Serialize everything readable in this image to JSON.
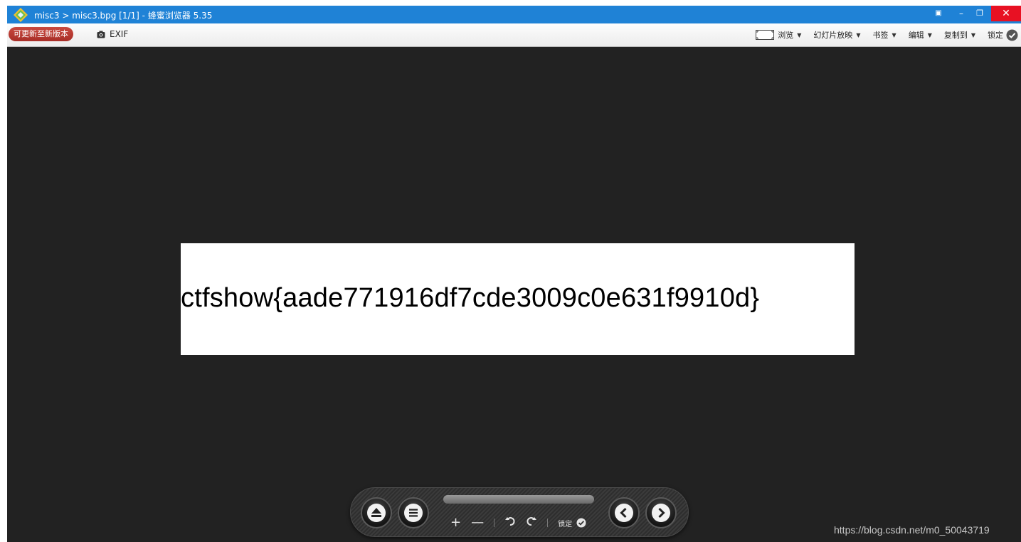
{
  "titlebar": {
    "title": "misc3 > misc3.bpg [1/1] - 蜂蜜浏览器 5.35",
    "close_symbol": "✕"
  },
  "toolbar": {
    "update_label": "可更新至新版本",
    "exif_label": "EXIF",
    "browse_label": "浏览",
    "slideshow_label": "幻灯片放映",
    "bookmark_label": "书签",
    "edit_label": "编辑",
    "copy_to_label": "复制到",
    "lock_label": "锁定"
  },
  "image": {
    "text": "ctfshow{aade771916df7cde3009c0e631f9910d}"
  },
  "controls": {
    "lock_label": "锁定",
    "zoom_in": "+",
    "zoom_out": "—"
  },
  "watermark": "https://blog.csdn.net/m0_50043719",
  "colors": {
    "titlebar": "#1f82d6",
    "background": "#222222",
    "close_button": "#e81123",
    "update_button": "#b8392f"
  }
}
